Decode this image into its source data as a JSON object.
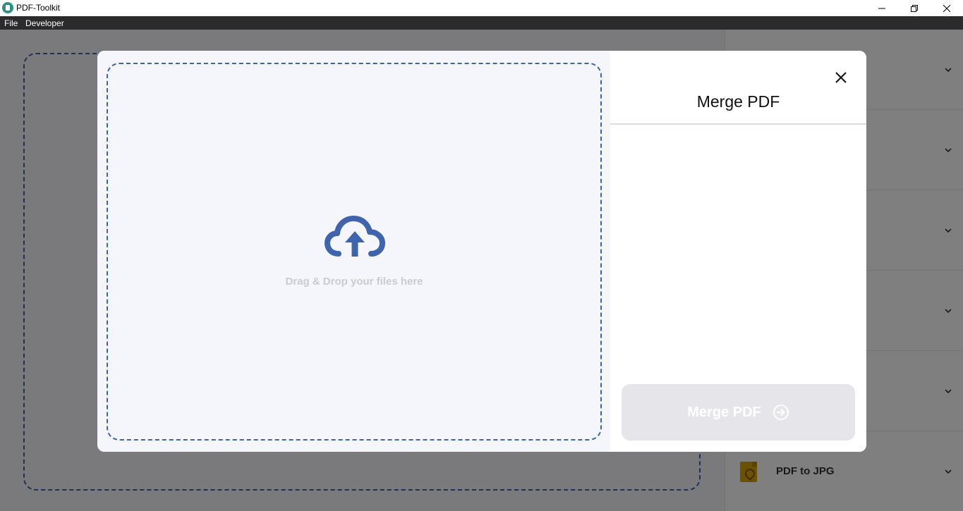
{
  "window": {
    "title": "PDF-Toolkit",
    "minimize_icon": "minimize-icon",
    "maximize_icon": "restore-icon",
    "close_icon": "close-icon"
  },
  "menu": {
    "items": [
      "File",
      "Developer"
    ]
  },
  "sidebar": {
    "items": [
      {
        "label": "",
        "icon": "chevron-down-icon"
      },
      {
        "label": "",
        "icon": "chevron-down-icon"
      },
      {
        "label": "",
        "icon": "chevron-down-icon"
      },
      {
        "label": "",
        "icon": "chevron-down-icon"
      },
      {
        "label": "",
        "icon": "chevron-down-icon"
      },
      {
        "label": "PDF to JPG",
        "icon": "pdf-file-icon"
      }
    ]
  },
  "modal": {
    "drop_text": "Drag & Drop your files here",
    "upload_icon": "cloud-upload-icon",
    "title": "Merge PDF",
    "close_icon": "close-icon",
    "action_label": "Merge PDF",
    "action_icon": "arrow-right-circle-icon"
  },
  "colors": {
    "accent": "#3f63ad",
    "menubar": "#2b2b2e",
    "button_disabled": "#e6e6ea",
    "pdf_icon": "#d9a300"
  }
}
